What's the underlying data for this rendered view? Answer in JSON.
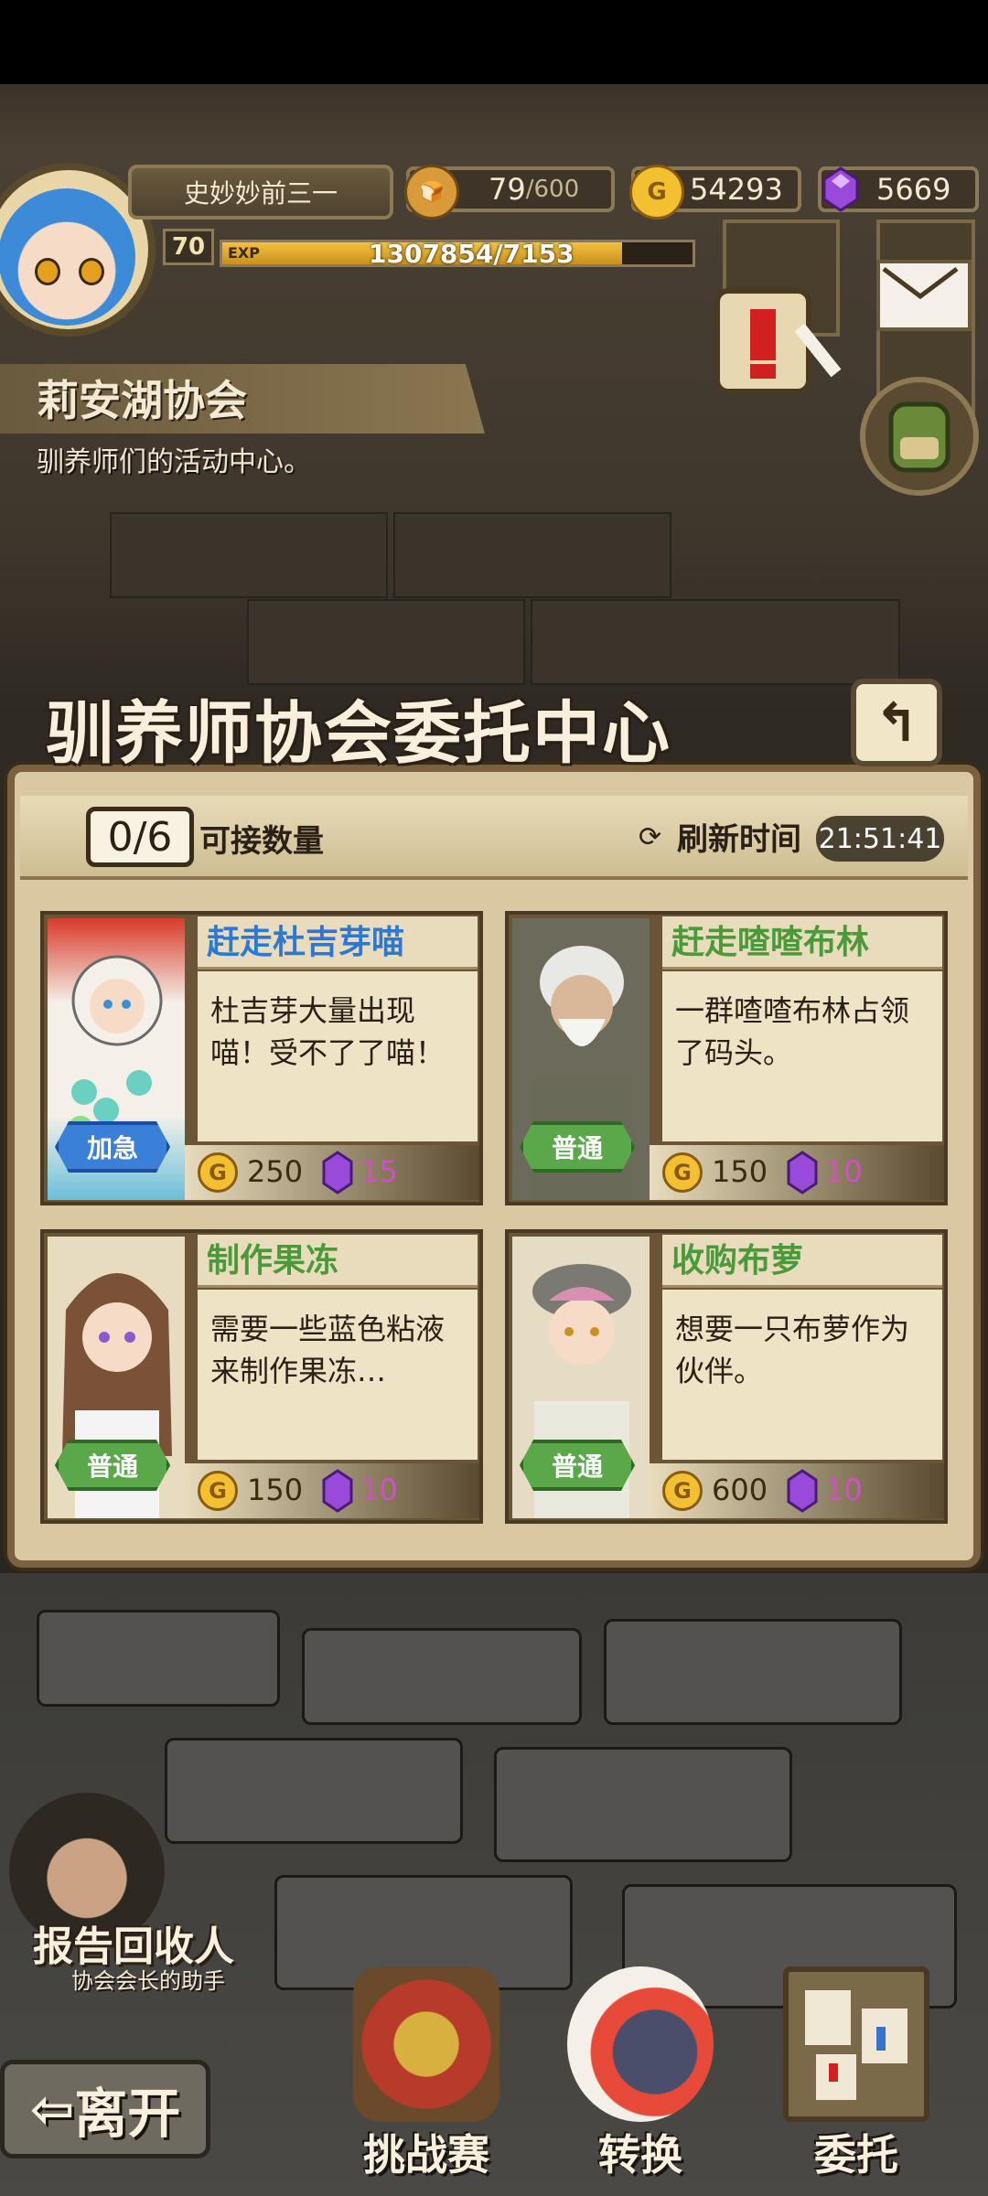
{
  "player": {
    "name": "史妙妙前三一",
    "level": "70",
    "exp_tag": "EXP",
    "exp_text": "1307854/7153",
    "exp_progress": 0.85
  },
  "resources": {
    "stamina": {
      "value": "79",
      "max": "/600"
    },
    "gold": "54293",
    "gems": "5669"
  },
  "location": {
    "title": "莉安湖协会",
    "description": "驯养师们的活动中心。"
  },
  "panel": {
    "title": "驯养师协会委托中心",
    "back_icon": "back-arrow-icon",
    "count": "0/6",
    "count_label": "可接数量",
    "refresh_label": "刷新时间",
    "refresh_time": "21:51:41"
  },
  "cards": [
    {
      "title": "赶走杜吉芽喵",
      "desc": "杜吉芽大量出现喵！受不了了喵！",
      "tag": "加急",
      "gold": "250",
      "gems": "15",
      "title_color": "#2f78d0"
    },
    {
      "title": "赶走喳喳布林",
      "desc": "一群喳喳布林占领了码头。",
      "tag": "普通",
      "gold": "150",
      "gems": "10",
      "title_color": "#4a9a3a"
    },
    {
      "title": "制作果冻",
      "desc": "需要一些蓝色粘液来制作果冻…",
      "tag": "普通",
      "gold": "150",
      "gems": "10",
      "title_color": "#4a9a3a"
    },
    {
      "title": "收购布萝",
      "desc": "想要一只布萝作为伙伴。",
      "tag": "普通",
      "gold": "600",
      "gems": "10",
      "title_color": "#4a9a3a"
    }
  ],
  "npc": {
    "name": "报告回收人",
    "subtitle": "协会会长的助手"
  },
  "bottom_nav": {
    "leave": "离开",
    "challenge": "挑战赛",
    "convert": "转换",
    "commission": "委托"
  },
  "colors": {
    "gold_coin": "#f2c030",
    "gem": "#9a4ad8",
    "tag_urgent": "#3a80d8",
    "tag_normal": "#5aa84a"
  }
}
